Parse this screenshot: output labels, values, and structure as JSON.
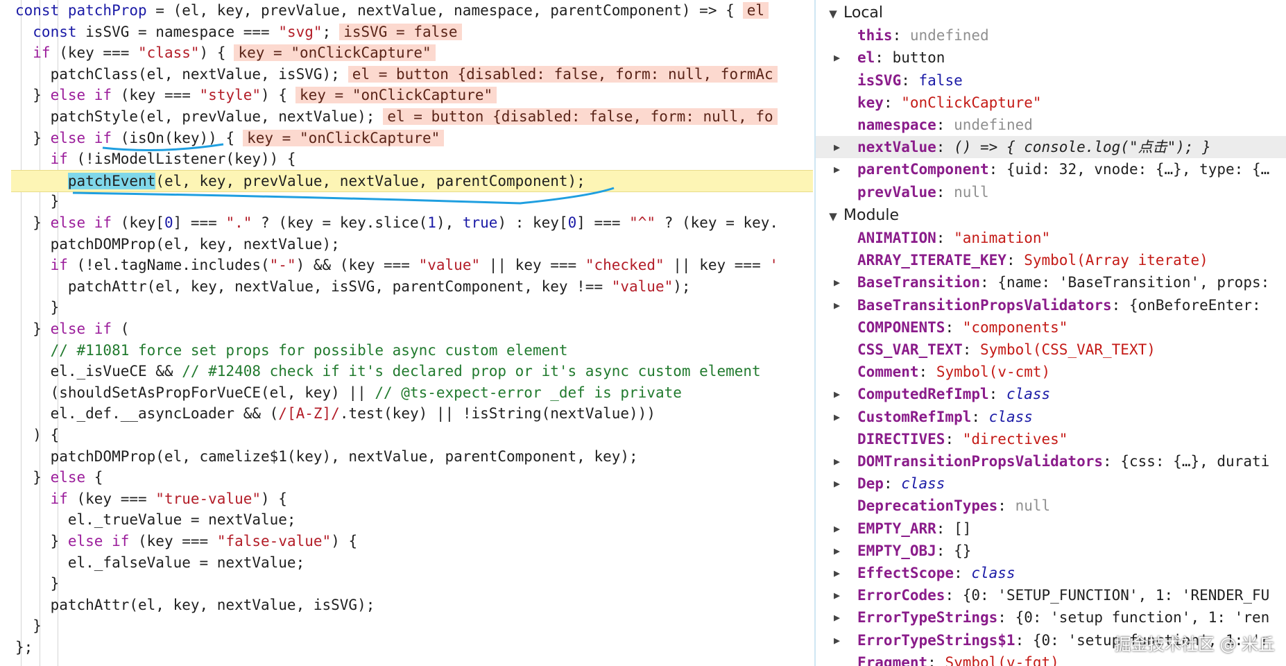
{
  "code": {
    "lines": [
      {
        "segs": [
          {
            "t": "const ",
            "c": "kwb"
          },
          {
            "t": "patchProp",
            "c": "var"
          },
          {
            "t": " = (el, key, prevValue, nextValue, namespace, parentComponent) => {"
          }
        ],
        "inline": "el"
      },
      {
        "segs": [
          {
            "t": "  const ",
            "c": "kwb"
          },
          {
            "t": "isSVG = namespace === "
          },
          {
            "t": "\"svg\"",
            "c": "str"
          },
          {
            "t": ";"
          }
        ],
        "inline": "isSVG = false"
      },
      {
        "segs": [
          {
            "t": "  if",
            "c": "kw"
          },
          {
            "t": " (key === "
          },
          {
            "t": "\"class\"",
            "c": "str"
          },
          {
            "t": ") {"
          }
        ],
        "inline": "key = \"onClickCapture\""
      },
      {
        "segs": [
          {
            "t": "    patchClass(el, nextValue, isSVG);"
          }
        ],
        "inline": "el = button {disabled: false, form: null, formAc"
      },
      {
        "segs": [
          {
            "t": "  } "
          },
          {
            "t": "else if",
            "c": "kw"
          },
          {
            "t": " (key === "
          },
          {
            "t": "\"style\"",
            "c": "str"
          },
          {
            "t": ") {"
          }
        ],
        "inline": "key = \"onClickCapture\""
      },
      {
        "segs": [
          {
            "t": "    patchStyle(el, prevValue, nextValue);"
          }
        ],
        "inline": "el = button {disabled: false, form: null, fo"
      },
      {
        "segs": [
          {
            "t": "  } "
          },
          {
            "t": "else if",
            "c": "kw"
          },
          {
            "t": " (isOn(key)) {"
          }
        ],
        "inline": "key = \"onClickCapture\""
      },
      {
        "segs": [
          {
            "t": "    if",
            "c": "kw"
          },
          {
            "t": " (!isModelListener(key)) {"
          }
        ]
      },
      {
        "exec": true,
        "segs": [
          {
            "t": "      "
          },
          {
            "t": "patchEvent",
            "c": "hl"
          },
          {
            "t": "(el, key, prevValue, nextValue, parentComponent);"
          }
        ]
      },
      {
        "segs": [
          {
            "t": "    }"
          }
        ]
      },
      {
        "segs": [
          {
            "t": "  } "
          },
          {
            "t": "else if",
            "c": "kw"
          },
          {
            "t": " (key["
          },
          {
            "t": "0",
            "c": "num"
          },
          {
            "t": "] === "
          },
          {
            "t": "\".\"",
            "c": "str"
          },
          {
            "t": " ? (key = key.slice("
          },
          {
            "t": "1",
            "c": "num"
          },
          {
            "t": "), "
          },
          {
            "t": "true",
            "c": "kwb"
          },
          {
            "t": ") : key["
          },
          {
            "t": "0",
            "c": "num"
          },
          {
            "t": "] === "
          },
          {
            "t": "\"^\"",
            "c": "str"
          },
          {
            "t": " ? (key = key."
          }
        ]
      },
      {
        "segs": [
          {
            "t": "    patchDOMProp(el, key, nextValue);"
          }
        ]
      },
      {
        "segs": [
          {
            "t": "    if",
            "c": "kw"
          },
          {
            "t": " (!el.tagName.includes("
          },
          {
            "t": "\"-\"",
            "c": "str"
          },
          {
            "t": ") && (key === "
          },
          {
            "t": "\"value\"",
            "c": "str"
          },
          {
            "t": " || key === "
          },
          {
            "t": "\"checked\"",
            "c": "str"
          },
          {
            "t": " || key === "
          },
          {
            "t": "'",
            "c": "str"
          }
        ]
      },
      {
        "segs": [
          {
            "t": "      patchAttr(el, key, nextValue, isSVG, parentComponent, key !== "
          },
          {
            "t": "\"value\"",
            "c": "str"
          },
          {
            "t": ");"
          }
        ]
      },
      {
        "segs": [
          {
            "t": "    }"
          }
        ]
      },
      {
        "segs": [
          {
            "t": "  } "
          },
          {
            "t": "else if",
            "c": "kw"
          },
          {
            "t": " ("
          }
        ]
      },
      {
        "segs": [
          {
            "t": "    // #11081 force set props for possible async custom element",
            "c": "cm"
          }
        ]
      },
      {
        "segs": [
          {
            "t": "    el._isVueCE && "
          },
          {
            "t": "// #12408 check if it's declared prop or it's async custom element",
            "c": "cm"
          }
        ]
      },
      {
        "segs": [
          {
            "t": "    (shouldSetAsPropForVueCE(el, key) || "
          },
          {
            "t": "// @ts-expect-error _def is private",
            "c": "cm"
          }
        ]
      },
      {
        "segs": [
          {
            "t": "    el._def.__asyncLoader && ("
          },
          {
            "t": "/[A-Z]/",
            "c": "re"
          },
          {
            "t": ".test(key) || !isString(nextValue)))"
          }
        ]
      },
      {
        "segs": [
          {
            "t": "  ) {"
          }
        ]
      },
      {
        "segs": [
          {
            "t": "    patchDOMProp(el, camelize$1(key), nextValue, parentComponent, key);"
          }
        ]
      },
      {
        "segs": [
          {
            "t": "  } "
          },
          {
            "t": "else",
            "c": "kw"
          },
          {
            "t": " {"
          }
        ]
      },
      {
        "segs": [
          {
            "t": "    if",
            "c": "kw"
          },
          {
            "t": " (key === "
          },
          {
            "t": "\"true-value\"",
            "c": "str"
          },
          {
            "t": ") {"
          }
        ]
      },
      {
        "segs": [
          {
            "t": "      el._trueValue = nextValue;"
          }
        ]
      },
      {
        "segs": [
          {
            "t": "    } "
          },
          {
            "t": "else if",
            "c": "kw"
          },
          {
            "t": " (key === "
          },
          {
            "t": "\"false-value\"",
            "c": "str"
          },
          {
            "t": ") {"
          }
        ]
      },
      {
        "segs": [
          {
            "t": "      el._falseValue = nextValue;"
          }
        ]
      },
      {
        "segs": [
          {
            "t": "    }"
          }
        ]
      },
      {
        "segs": [
          {
            "t": "    patchAttr(el, key, nextValue, isSVG);"
          }
        ]
      },
      {
        "segs": [
          {
            "t": "  }"
          }
        ]
      },
      {
        "segs": [
          {
            "t": "};"
          }
        ]
      }
    ]
  },
  "scope": {
    "local": {
      "label": "Local",
      "items": [
        {
          "key": "this",
          "val": "undefined",
          "type": "undef",
          "exp": false
        },
        {
          "key": "el",
          "val": "button",
          "type": "el",
          "exp": true
        },
        {
          "key": "isSVG",
          "val": "false",
          "type": "bool",
          "exp": false
        },
        {
          "key": "key",
          "val": "\"onClickCapture\"",
          "type": "str",
          "exp": false
        },
        {
          "key": "namespace",
          "val": "undefined",
          "type": "undef",
          "exp": false
        },
        {
          "key": "nextValue",
          "val": "() => { console.log(\"点击\"); }",
          "type": "fn",
          "exp": true,
          "selected": true
        },
        {
          "key": "parentComponent",
          "val": "{uid: 32, vnode: {…}, type: {…",
          "type": "obj",
          "exp": true
        },
        {
          "key": "prevValue",
          "val": "null",
          "type": "null",
          "exp": false
        }
      ]
    },
    "module": {
      "label": "Module",
      "items": [
        {
          "key": "ANIMATION",
          "val": "\"animation\"",
          "type": "str",
          "exp": false
        },
        {
          "key": "ARRAY_ITERATE_KEY",
          "val": "Symbol(Array iterate)",
          "type": "sym",
          "exp": false
        },
        {
          "key": "BaseTransition",
          "val": "{name: 'BaseTransition', props:",
          "type": "obj",
          "exp": true
        },
        {
          "key": "BaseTransitionPropsValidators",
          "val": "{onBeforeEnter:",
          "type": "obj",
          "exp": true
        },
        {
          "key": "COMPONENTS",
          "val": "\"components\"",
          "type": "str",
          "exp": false
        },
        {
          "key": "CSS_VAR_TEXT",
          "val": "Symbol(CSS_VAR_TEXT)",
          "type": "sym",
          "exp": false
        },
        {
          "key": "Comment",
          "val": "Symbol(v-cmt)",
          "type": "sym",
          "exp": false
        },
        {
          "key": "ComputedRefImpl",
          "val": "class",
          "type": "class",
          "exp": true
        },
        {
          "key": "CustomRefImpl",
          "val": "class",
          "type": "class",
          "exp": true
        },
        {
          "key": "DIRECTIVES",
          "val": "\"directives\"",
          "type": "str",
          "exp": false
        },
        {
          "key": "DOMTransitionPropsValidators",
          "val": "{css: {…}, durati",
          "type": "obj",
          "exp": true
        },
        {
          "key": "Dep",
          "val": "class",
          "type": "class",
          "exp": true
        },
        {
          "key": "DeprecationTypes",
          "val": "null",
          "type": "null",
          "exp": false
        },
        {
          "key": "EMPTY_ARR",
          "val": "[]",
          "type": "obj",
          "exp": true
        },
        {
          "key": "EMPTY_OBJ",
          "val": "{}",
          "type": "obj",
          "exp": true
        },
        {
          "key": "EffectScope",
          "val": "class",
          "type": "class",
          "exp": true
        },
        {
          "key": "ErrorCodes",
          "val": "{0: 'SETUP_FUNCTION', 1: 'RENDER_FU",
          "type": "obj",
          "exp": true
        },
        {
          "key": "ErrorTypeStrings",
          "val": "{0: 'setup function', 1: 'ren",
          "type": "obj",
          "exp": true
        },
        {
          "key": "ErrorTypeStrings$1",
          "val": "{0: 'setup function', 1: 'r",
          "type": "obj",
          "exp": true
        },
        {
          "key": "Fragment",
          "val": "Symbol(v-fgt)",
          "type": "sym",
          "exp": false
        }
      ]
    }
  },
  "watermark": "掘金技术社区 @ 米丘",
  "colors": {
    "exec_line_bg": "#fdf5b5",
    "inline_value_bg": "#fcd9cf",
    "highlight_bg": "#7fd7ea",
    "annotation_stroke": "#1f9fe0"
  }
}
